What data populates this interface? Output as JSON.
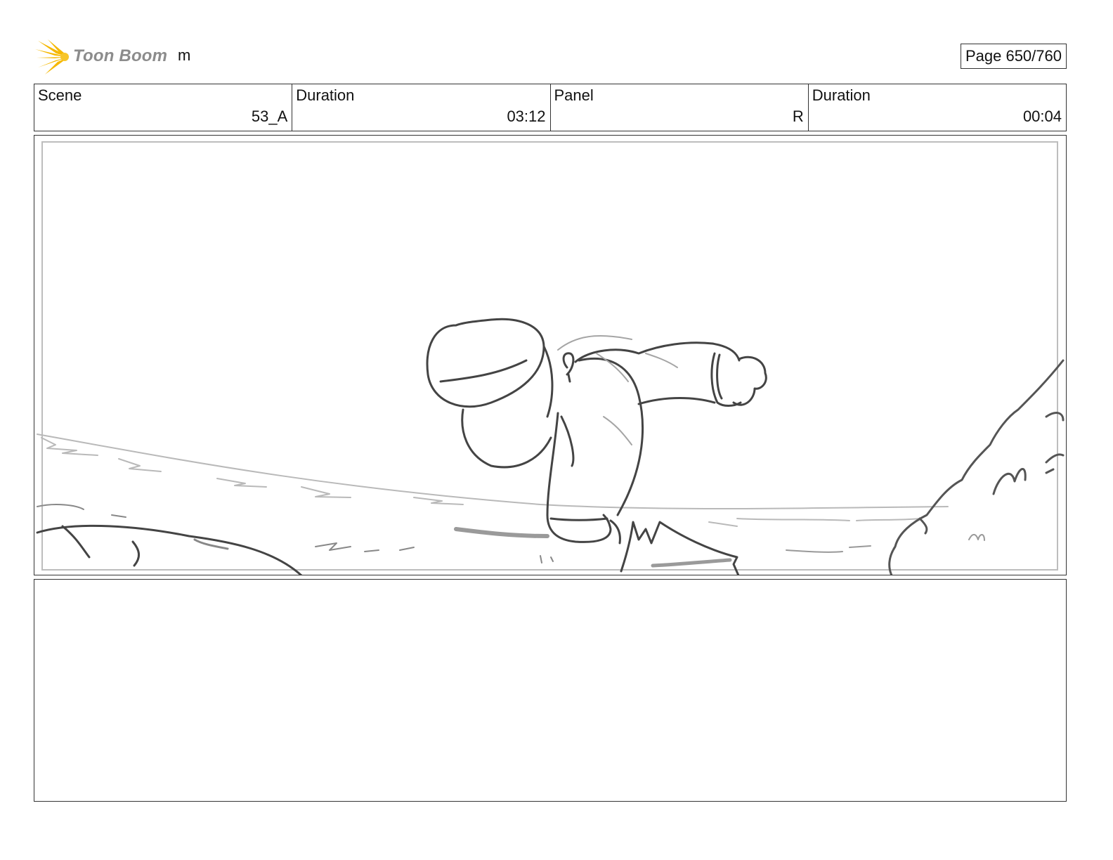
{
  "header": {
    "logo_text": "Toon Boom",
    "project_name": "m",
    "page_label": "Page 650/760"
  },
  "info": {
    "scene_label": "Scene",
    "scene_value": "53_A",
    "scene_duration_label": "Duration",
    "scene_duration_value": "03:12",
    "panel_label": "Panel",
    "panel_value": "R",
    "panel_duration_label": "Duration",
    "panel_duration_value": "00:04"
  },
  "notes": {
    "text": ""
  }
}
